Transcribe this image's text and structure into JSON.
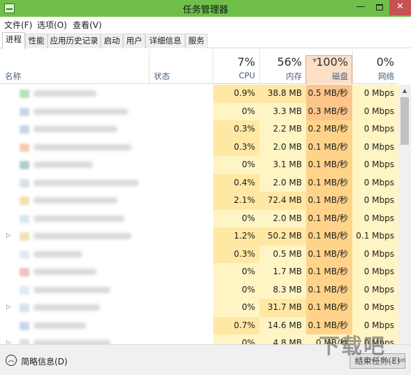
{
  "window": {
    "title": "任务管理器"
  },
  "menu": {
    "file": "文件(F)",
    "options": "选项(O)",
    "view": "查看(V)"
  },
  "tabs": [
    "进程",
    "性能",
    "应用历史记录",
    "启动",
    "用户",
    "详细信息",
    "服务"
  ],
  "header": {
    "name": "名称",
    "status": "状态",
    "cpu": {
      "pct": "7%",
      "label": "CPU"
    },
    "memory": {
      "pct": "56%",
      "label": "内存"
    },
    "disk": {
      "pct": "100%",
      "label": "磁盘"
    },
    "network": {
      "pct": "0%",
      "label": "网络"
    }
  },
  "rows": [
    {
      "cpu": "0.9%",
      "mem": "38.8 MB",
      "disk": "0.5 MB/秒",
      "net": "0 Mbps",
      "icon_color": "#7fc97f"
    },
    {
      "cpu": "0%",
      "mem": "3.3 MB",
      "disk": "0.3 MB/秒",
      "net": "0 Mbps",
      "icon_color": "#9bb7d6"
    },
    {
      "cpu": "0.3%",
      "mem": "2.2 MB",
      "disk": "0.2 MB/秒",
      "net": "0 Mbps",
      "icon_color": "#9bb7d6"
    },
    {
      "cpu": "0.3%",
      "mem": "2.0 MB",
      "disk": "0.1 MB/秒",
      "net": "0 Mbps",
      "icon_color": "#f0a36a"
    },
    {
      "cpu": "0%",
      "mem": "3.1 MB",
      "disk": "0.1 MB/秒",
      "net": "0 Mbps",
      "icon_color": "#6aa3a8"
    },
    {
      "cpu": "0.4%",
      "mem": "2.0 MB",
      "disk": "0.1 MB/秒",
      "net": "0 Mbps",
      "icon_color": "#b9c9d9"
    },
    {
      "cpu": "2.1%",
      "mem": "72.4 MB",
      "disk": "0.1 MB/秒",
      "net": "0 Mbps",
      "icon_color": "#e6c96a"
    },
    {
      "cpu": "0%",
      "mem": "2.0 MB",
      "disk": "0.1 MB/秒",
      "net": "0 Mbps",
      "icon_color": "#b9d6e6"
    },
    {
      "cpu": "1.2%",
      "mem": "50.2 MB",
      "disk": "0.1 MB/秒",
      "net": "0.1 Mbps",
      "icon_color": "#e6c96a",
      "expandable": true
    },
    {
      "cpu": "0.3%",
      "mem": "0.5 MB",
      "disk": "0.1 MB/秒",
      "net": "0 Mbps",
      "icon_color": "#c9d9e6"
    },
    {
      "cpu": "0%",
      "mem": "1.7 MB",
      "disk": "0.1 MB/秒",
      "net": "0 Mbps",
      "icon_color": "#e88a8a"
    },
    {
      "cpu": "0%",
      "mem": "8.3 MB",
      "disk": "0.1 MB/秒",
      "net": "0 Mbps",
      "icon_color": "#c9d9e6"
    },
    {
      "cpu": "0%",
      "mem": "31.7 MB",
      "disk": "0.1 MB/秒",
      "net": "0 Mbps",
      "icon_color": "#b9c9d9",
      "expandable": true
    },
    {
      "cpu": "0.7%",
      "mem": "14.6 MB",
      "disk": "0.1 MB/秒",
      "net": "0 Mbps",
      "icon_color": "#9bb7d6"
    },
    {
      "cpu": "0%",
      "mem": "4.8 MB",
      "disk": "0 MB/秒",
      "net": "0 Mbps",
      "icon_color": "#b9c9d9",
      "expandable": true
    }
  ],
  "footer": {
    "fewer_details": "简略信息(D)",
    "end_task": "结束任务(E)"
  },
  "watermark": {
    "big": "下载吧",
    "small": "xiazaiba.com"
  },
  "colors": {
    "titlebar": "#6fbf4a",
    "heat_light": "#fff4c4",
    "heat_medium": "#ffe8a3",
    "heat_disk_high": "#fcc58a",
    "heat_disk_mid": "#ffd48a",
    "disk_header_border": "#f0a56d",
    "close_button": "#c75050"
  }
}
